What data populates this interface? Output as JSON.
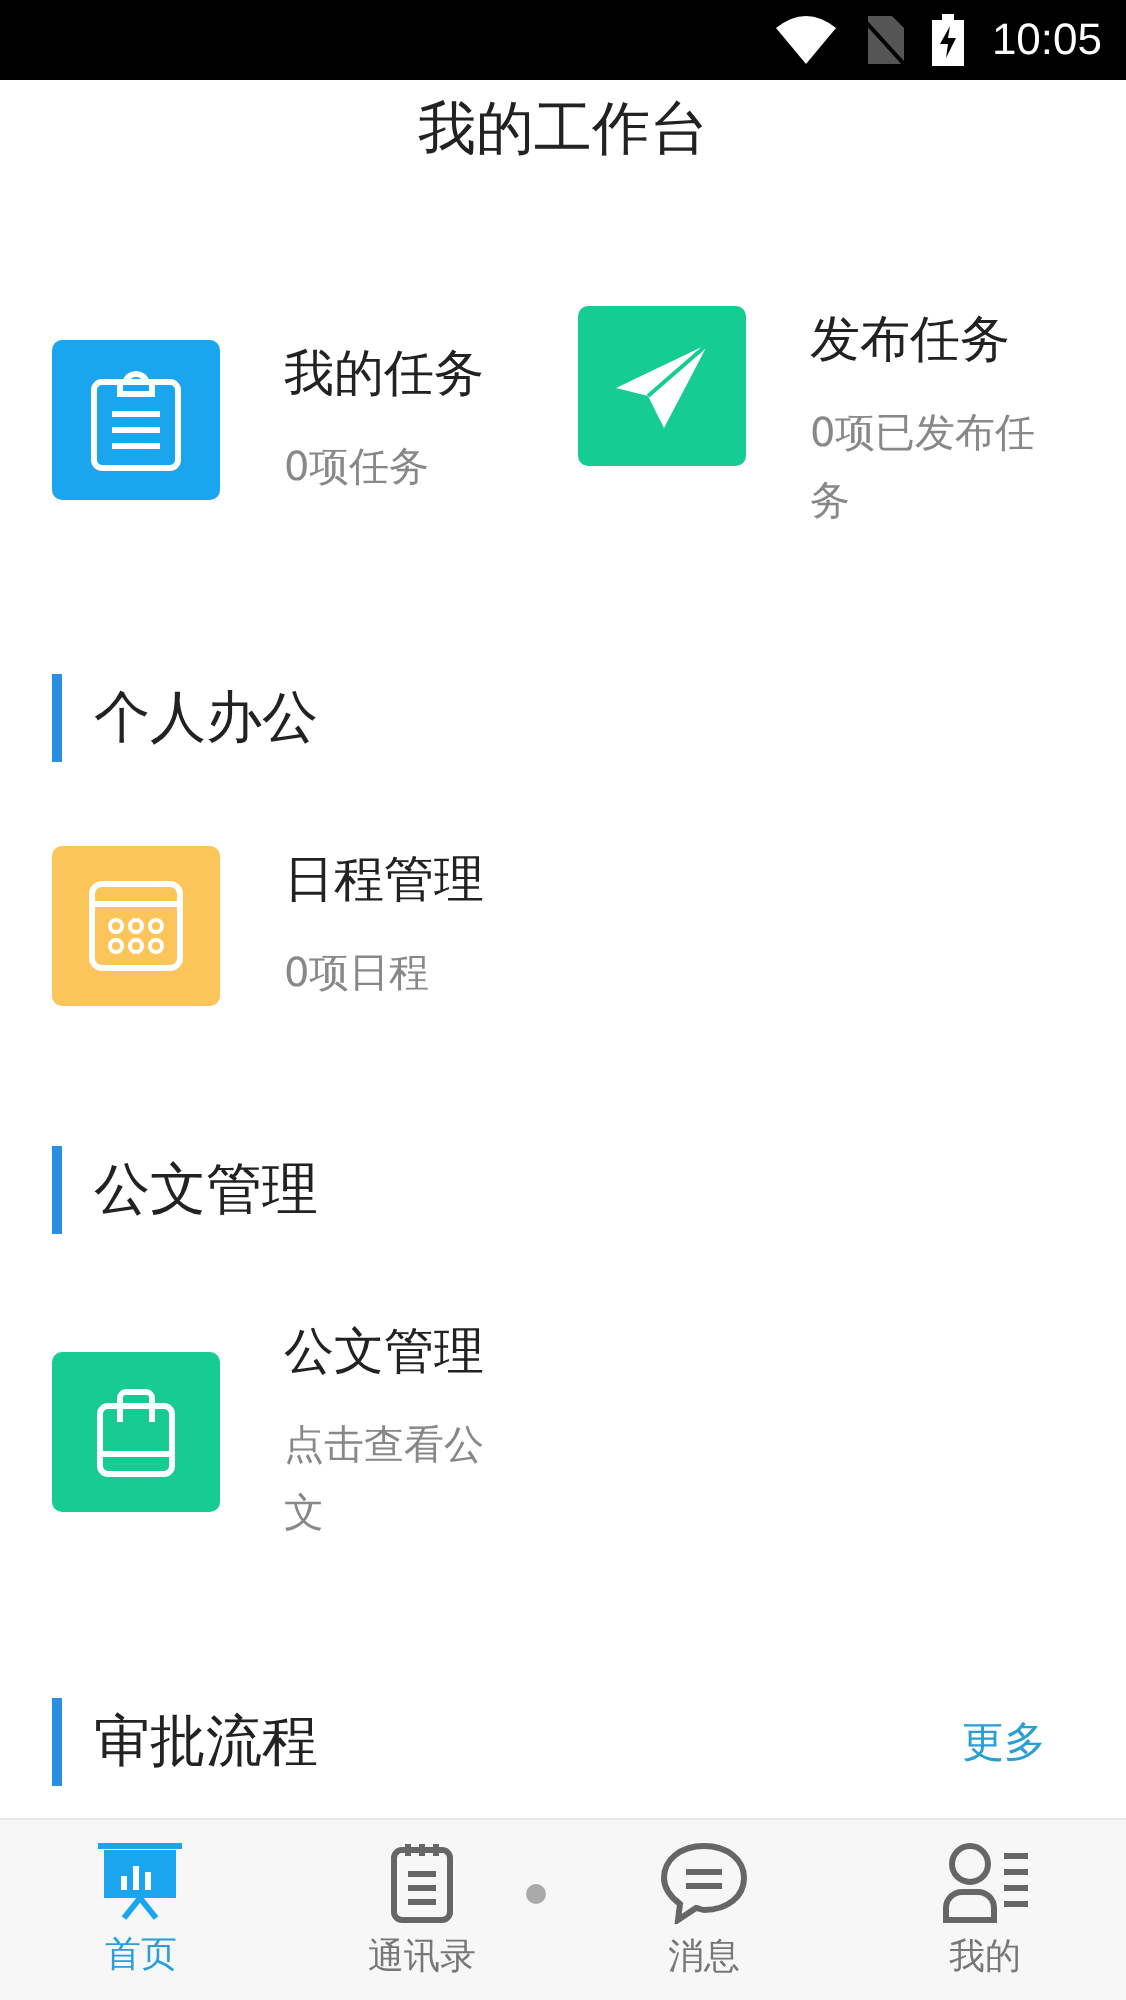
{
  "status_bar": {
    "time": "10:05"
  },
  "header": {
    "title": "我的工作台"
  },
  "task_tiles": [
    {
      "kind": "clipboard",
      "color": "#1aa6ee",
      "title": "我的任务",
      "subtitle": "0项任务"
    },
    {
      "kind": "plane",
      "color": "#15cc92",
      "title": "发布任务",
      "subtitle": "0项已发布任务"
    }
  ],
  "sections": [
    {
      "title": "个人办公",
      "tiles": [
        {
          "kind": "calendar",
          "color": "#fbc55a",
          "title": "日程管理",
          "subtitle": "0项日程"
        }
      ]
    },
    {
      "title": "公文管理",
      "tiles": [
        {
          "kind": "bag",
          "color": "#16cc92",
          "title": "公文管理",
          "subtitle": "点击查看公文"
        }
      ]
    },
    {
      "title": "审批流程",
      "more_link": "更多"
    }
  ],
  "tab_bar": [
    {
      "kind": "home",
      "label": "首页",
      "selected": true
    },
    {
      "kind": "contacts",
      "label": "通讯录",
      "selected": false
    },
    {
      "kind": "messages",
      "label": "消息",
      "selected": false
    },
    {
      "kind": "profile",
      "label": "我的",
      "selected": false
    }
  ]
}
